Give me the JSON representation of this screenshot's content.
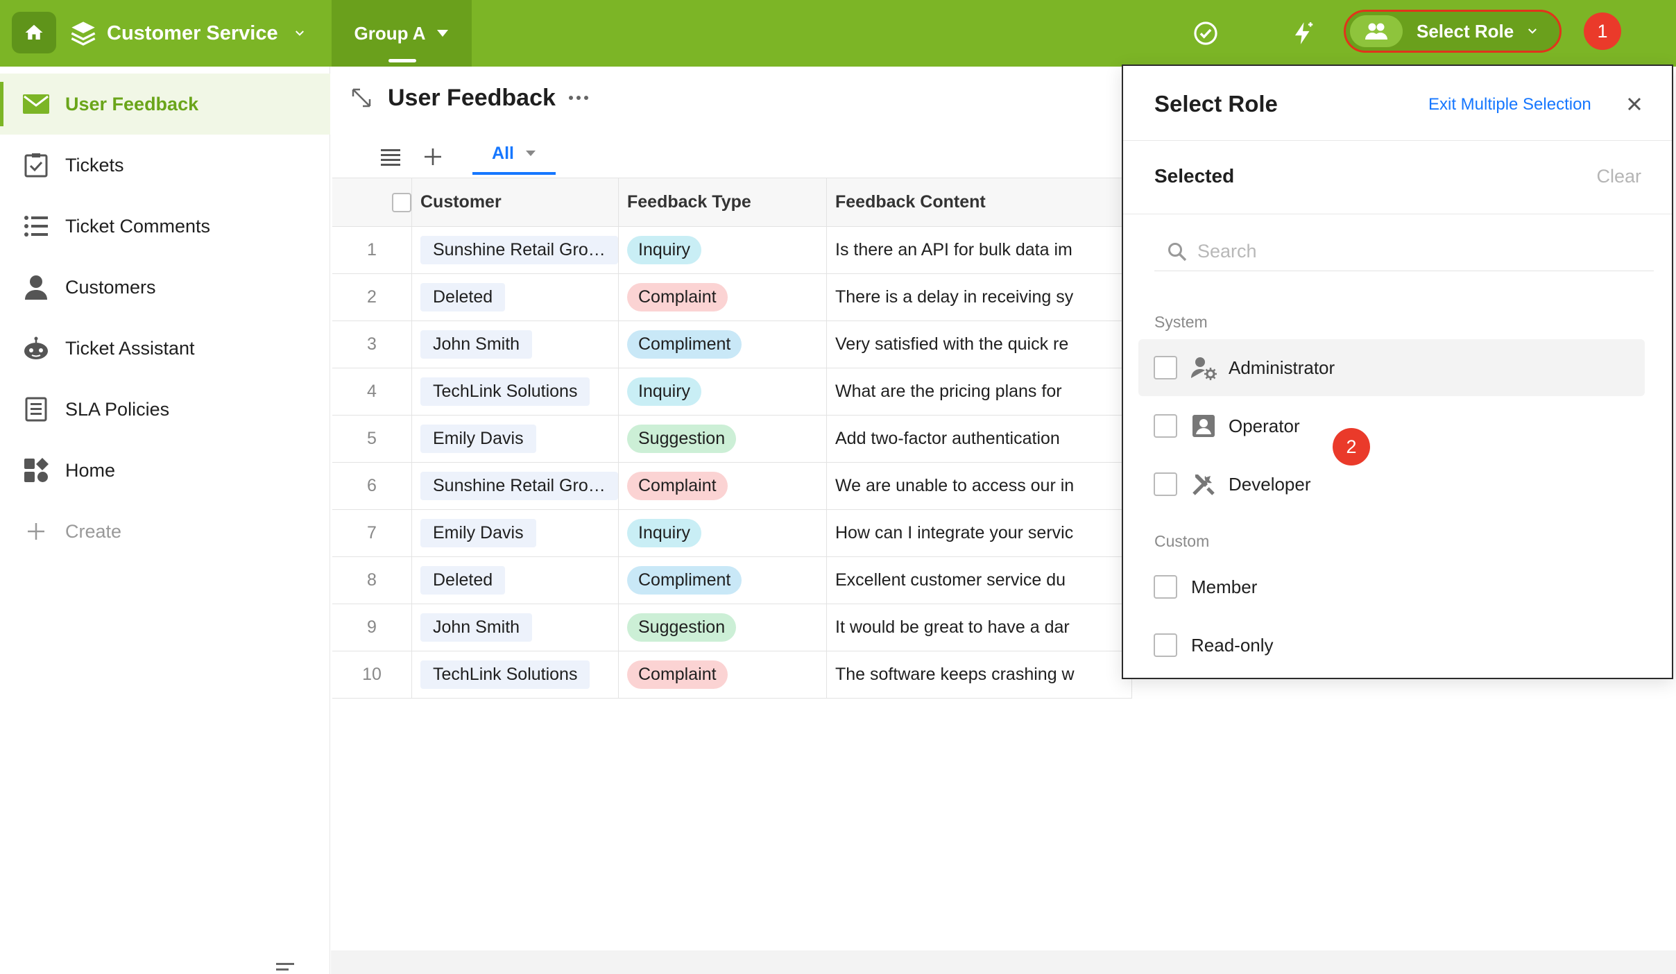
{
  "topbar": {
    "app_title": "Customer Service",
    "group_label": "Group A",
    "select_role_label": "Select Role",
    "badge_1": "1",
    "accent": "#7cb526"
  },
  "sidebar": {
    "items": [
      {
        "label": "User Feedback",
        "icon": "envelope-icon"
      },
      {
        "label": "Tickets",
        "icon": "clipboard-check-icon"
      },
      {
        "label": "Ticket Comments",
        "icon": "list-icon"
      },
      {
        "label": "Customers",
        "icon": "person-icon"
      },
      {
        "label": "Ticket Assistant",
        "icon": "robot-icon"
      },
      {
        "label": "SLA Policies",
        "icon": "document-icon"
      },
      {
        "label": "Home",
        "icon": "dashboard-icon"
      }
    ],
    "create_label": "Create"
  },
  "main": {
    "title": "User Feedback",
    "view_tab": "All",
    "columns": [
      "Customer",
      "Feedback Type",
      "Feedback Content"
    ],
    "rows": [
      {
        "n": "1",
        "customer": "Sunshine Retail Gro…",
        "type": "Inquiry",
        "content": "Is there an API for bulk data im"
      },
      {
        "n": "2",
        "customer": "Deleted",
        "type": "Complaint",
        "content": "There is a delay in receiving sy"
      },
      {
        "n": "3",
        "customer": "John Smith",
        "type": "Compliment",
        "content": "Very satisfied with the quick re"
      },
      {
        "n": "4",
        "customer": "TechLink Solutions",
        "type": "Inquiry",
        "content": "What are the pricing plans for"
      },
      {
        "n": "5",
        "customer": "Emily Davis",
        "type": "Suggestion",
        "content": "Add two-factor authentication"
      },
      {
        "n": "6",
        "customer": "Sunshine Retail Gro…",
        "type": "Complaint",
        "content": "We are unable to access our in"
      },
      {
        "n": "7",
        "customer": "Emily Davis",
        "type": "Inquiry",
        "content": "How can I integrate your servic"
      },
      {
        "n": "8",
        "customer": "Deleted",
        "type": "Compliment",
        "content": "Excellent customer service du"
      },
      {
        "n": "9",
        "customer": "John Smith",
        "type": "Suggestion",
        "content": "It would be great to have a dar"
      },
      {
        "n": "10",
        "customer": "TechLink Solutions",
        "type": "Complaint",
        "content": "The software keeps crashing w"
      }
    ],
    "type_colors": {
      "Inquiry": "#c9eef5",
      "Complaint": "#fbd3d3",
      "Compliment": "#c9e8f7",
      "Suggestion": "#ccefd6"
    }
  },
  "panel": {
    "title": "Select Role",
    "exit_label": "Exit Multiple Selection",
    "selected_label": "Selected",
    "clear_label": "Clear",
    "search_placeholder": "Search",
    "system_label": "System",
    "system_roles": [
      {
        "label": "Administrator",
        "icon": "admin-gear-icon"
      },
      {
        "label": "Operator",
        "icon": "id-badge-icon"
      },
      {
        "label": "Developer",
        "icon": "tools-icon"
      }
    ],
    "custom_label": "Custom",
    "custom_roles": [
      {
        "label": "Member"
      },
      {
        "label": "Read-only"
      }
    ],
    "badge_2": "2"
  }
}
